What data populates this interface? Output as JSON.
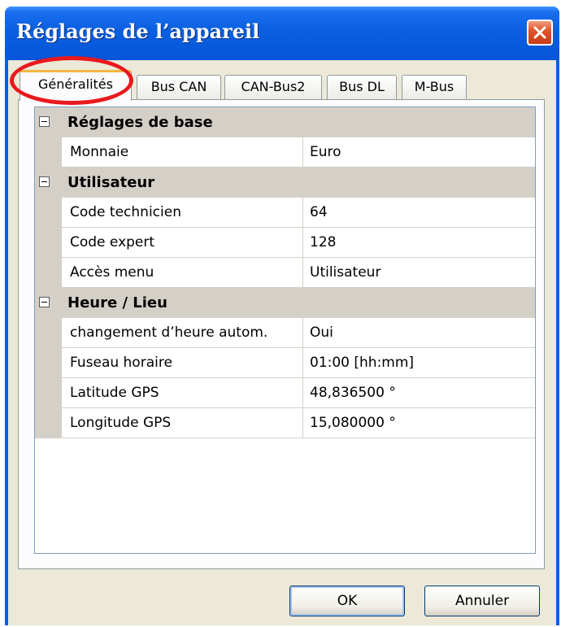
{
  "window": {
    "title": "Réglages de l’appareil",
    "close_icon": "close-icon",
    "accent_color": "#0a5fe0"
  },
  "tabs": [
    {
      "label": "Généralités",
      "active": true
    },
    {
      "label": "Bus CAN",
      "active": false
    },
    {
      "label": "CAN-Bus2",
      "active": false
    },
    {
      "label": "Bus DL",
      "active": false
    },
    {
      "label": "M-Bus",
      "active": false
    }
  ],
  "grid": {
    "categories": [
      {
        "label": "Réglages de base",
        "expanded": true,
        "rows": [
          {
            "property": "Monnaie",
            "value": "Euro"
          }
        ]
      },
      {
        "label": "Utilisateur",
        "expanded": true,
        "rows": [
          {
            "property": "Code technicien",
            "value": "64"
          },
          {
            "property": "Code expert",
            "value": "128"
          },
          {
            "property": "Accès menu",
            "value": "Utilisateur"
          }
        ]
      },
      {
        "label": "Heure / Lieu",
        "expanded": true,
        "rows": [
          {
            "property": "changement d’heure autom.",
            "value": "Oui"
          },
          {
            "property": "Fuseau horaire",
            "value": "01:00 [hh:mm]"
          },
          {
            "property": "Latitude GPS",
            "value": "48,836500 °"
          },
          {
            "property": "Longitude GPS",
            "value": "15,080000 °"
          }
        ]
      }
    ]
  },
  "buttons": {
    "ok": "OK",
    "cancel": "Annuler"
  },
  "annotation": {
    "highlight_color": "#e8191d"
  }
}
